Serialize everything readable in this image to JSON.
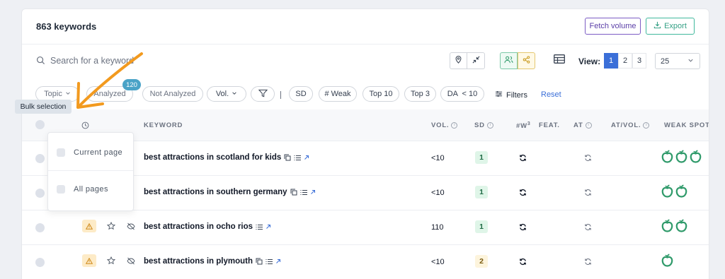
{
  "header": {
    "title": "863 keywords",
    "fetch_label": "Fetch volume",
    "export_label": "Export"
  },
  "search": {
    "placeholder": "Search for a keyword"
  },
  "view": {
    "label": "View:",
    "pages": [
      "1",
      "2",
      "3"
    ],
    "active_page": "1",
    "per_page": "25"
  },
  "filters": {
    "topic": "Topic",
    "analyzed": "Analyzed",
    "analyzed_badge": "120",
    "not_analyzed": "Not Analyzed",
    "vol": "Vol.",
    "sd": "SD",
    "weak": "# Weak",
    "top10": "Top 10",
    "top3": "Top 3",
    "da": "DA  < 10",
    "filters_label": "Filters",
    "reset_label": "Reset"
  },
  "tooltip": "Bulk selection",
  "bulk_menu": {
    "current_page": "Current page",
    "all_pages": "All pages"
  },
  "columns": {
    "keyword": "KEYWORD",
    "vol": "VOL.",
    "sd": "SD",
    "w3": "#W",
    "w3_sup": "3",
    "feat": "FEAT.",
    "at": "AT",
    "at_vol": "AT/VOL.",
    "weak_spots": "WEAK SPOTS"
  },
  "rows": [
    {
      "keyword": "best attractions in scotland for kids",
      "vol": "<10",
      "sd": "1",
      "weak_count": 3
    },
    {
      "keyword": "best attractions in southern germany",
      "vol": "<10",
      "sd": "1",
      "weak_count": 2
    },
    {
      "keyword": "best attractions in ocho rios",
      "vol": "110",
      "sd": "1",
      "weak_count": 2
    },
    {
      "keyword": "best attractions in plymouth",
      "vol": "<10",
      "sd": "2",
      "weak_count": 1
    }
  ],
  "colors": {
    "accent": "#3b6fd8",
    "fetch": "#7c5cc4",
    "export": "#40b89c",
    "weak": "#2f9a6a",
    "annotation": "#f29a1f"
  }
}
